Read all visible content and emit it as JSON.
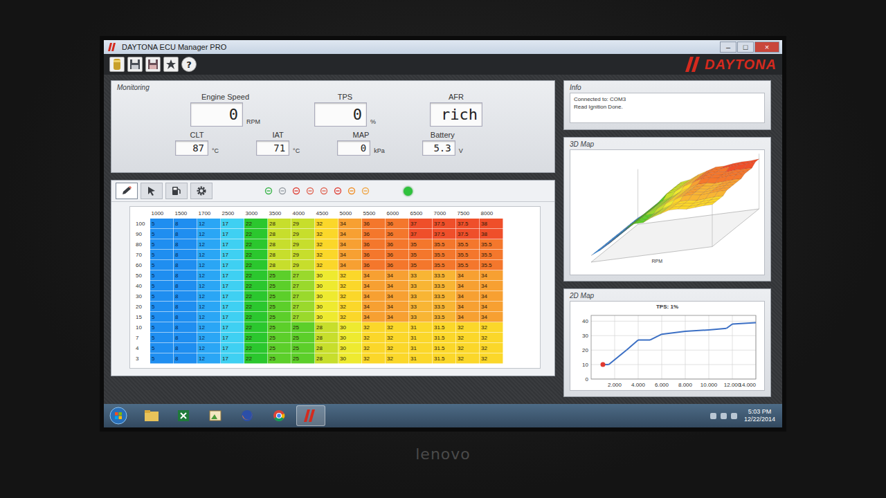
{
  "window": {
    "title": "DAYTONA ECU Manager PRO",
    "controls": [
      "–",
      "□",
      "×"
    ]
  },
  "toolbar": {
    "help_glyph": "?"
  },
  "logo": {
    "text": "DAYTONA"
  },
  "monitoring": {
    "title": "Monitoring",
    "gauges": [
      {
        "label": "Engine Speed",
        "value": "0",
        "unit": "RPM"
      },
      {
        "label": "TPS",
        "value": "0",
        "unit": "%"
      },
      {
        "label": "AFR",
        "value": "rich"
      },
      {
        "label": "CLT",
        "value": "87",
        "unit": "°C"
      },
      {
        "label": "IAT",
        "value": "71",
        "unit": "°C"
      },
      {
        "label": "MAP",
        "value": "0",
        "unit": "kPa"
      },
      {
        "label": "Battery",
        "value": "5.3",
        "unit": "V"
      }
    ]
  },
  "info": {
    "title": "Info",
    "lines": [
      "Connected to: COM3",
      "Read Ignition Done."
    ]
  },
  "editor": {
    "tabs": [
      {
        "selected": true
      },
      {
        "selected": false
      },
      {
        "selected": false
      },
      {
        "selected": false
      }
    ],
    "connected": true
  },
  "table": {
    "columns": [
      "1000",
      "1500",
      "1700",
      "2500",
      "3000",
      "3500",
      "4000",
      "4500",
      "5000",
      "5500",
      "6000",
      "6500",
      "7000",
      "7500",
      "8000"
    ],
    "rows": [
      {
        "load": "100",
        "cells": [
          "5",
          "8",
          "12",
          "17",
          "22",
          "28",
          "29",
          "32",
          "34",
          "36",
          "36",
          "37",
          "37.5",
          "37.5",
          "38"
        ]
      },
      {
        "load": "90",
        "cells": [
          "5",
          "8",
          "12",
          "17",
          "22",
          "28",
          "29",
          "32",
          "34",
          "36",
          "36",
          "37",
          "37.5",
          "37.5",
          "38"
        ]
      },
      {
        "load": "80",
        "cells": [
          "5",
          "8",
          "12",
          "17",
          "22",
          "28",
          "29",
          "32",
          "34",
          "36",
          "36",
          "35",
          "35.5",
          "35.5",
          "35.5"
        ]
      },
      {
        "load": "70",
        "cells": [
          "5",
          "8",
          "12",
          "17",
          "22",
          "28",
          "29",
          "32",
          "34",
          "36",
          "36",
          "35",
          "35.5",
          "35.5",
          "35.5"
        ]
      },
      {
        "load": "60",
        "cells": [
          "5",
          "8",
          "12",
          "17",
          "22",
          "28",
          "29",
          "32",
          "34",
          "36",
          "36",
          "35",
          "35.5",
          "35.5",
          "35.5"
        ]
      },
      {
        "load": "50",
        "cells": [
          "5",
          "8",
          "12",
          "17",
          "22",
          "25",
          "27",
          "30",
          "32",
          "34",
          "34",
          "33",
          "33.5",
          "34",
          "34"
        ]
      },
      {
        "load": "40",
        "cells": [
          "5",
          "8",
          "12",
          "17",
          "22",
          "25",
          "27",
          "30",
          "32",
          "34",
          "34",
          "33",
          "33.5",
          "34",
          "34"
        ]
      },
      {
        "load": "30",
        "cells": [
          "5",
          "8",
          "12",
          "17",
          "22",
          "25",
          "27",
          "30",
          "32",
          "34",
          "34",
          "33",
          "33.5",
          "34",
          "34"
        ]
      },
      {
        "load": "20",
        "cells": [
          "5",
          "8",
          "12",
          "17",
          "22",
          "25",
          "27",
          "30",
          "32",
          "34",
          "34",
          "33",
          "33.5",
          "34",
          "34"
        ]
      },
      {
        "load": "15",
        "cells": [
          "5",
          "8",
          "12",
          "17",
          "22",
          "25",
          "27",
          "30",
          "32",
          "34",
          "34",
          "33",
          "33.5",
          "34",
          "34"
        ]
      },
      {
        "load": "10",
        "cells": [
          "5",
          "8",
          "12",
          "17",
          "22",
          "25",
          "25",
          "28",
          "30",
          "32",
          "32",
          "31",
          "31.5",
          "32",
          "32"
        ]
      },
      {
        "load": "7",
        "cells": [
          "5",
          "8",
          "12",
          "17",
          "22",
          "25",
          "25",
          "28",
          "30",
          "32",
          "32",
          "31",
          "31.5",
          "32",
          "32"
        ]
      },
      {
        "load": "4",
        "cells": [
          "5",
          "8",
          "12",
          "17",
          "22",
          "25",
          "25",
          "28",
          "30",
          "32",
          "32",
          "31",
          "31.5",
          "32",
          "32"
        ]
      },
      {
        "load": "3",
        "cells": [
          "5",
          "8",
          "12",
          "17",
          "22",
          "25",
          "25",
          "28",
          "30",
          "32",
          "32",
          "31",
          "31.5",
          "32",
          "32"
        ]
      }
    ]
  },
  "map3d": {
    "title": "3D Map",
    "axis_label": "RPM"
  },
  "map2d": {
    "title": "2D Map",
    "chart_title": "TPS: 1%",
    "y_ticks": [
      "40",
      "30",
      "20",
      "10",
      "0"
    ],
    "x_ticks": [
      "2.000",
      "4.000",
      "6.000",
      "8.000",
      "10.000",
      "12.000",
      "14.000"
    ],
    "series": {
      "x": [
        1000,
        1500,
        3000,
        4000,
        5000,
        6000,
        8000,
        10000,
        11500,
        12000,
        14000
      ],
      "y": [
        10,
        10,
        20,
        27,
        27,
        31,
        33,
        34,
        35,
        38,
        39
      ]
    },
    "marker_index": 0
  },
  "taskbar": {
    "apps": [
      {
        "active": false
      },
      {
        "active": false
      },
      {
        "active": false
      },
      {
        "active": false
      },
      {
        "active": false
      },
      {
        "active": true
      }
    ],
    "time": "5:03 PM",
    "date": "12/22/2014"
  },
  "bezel": {
    "brand": "lenovo"
  }
}
